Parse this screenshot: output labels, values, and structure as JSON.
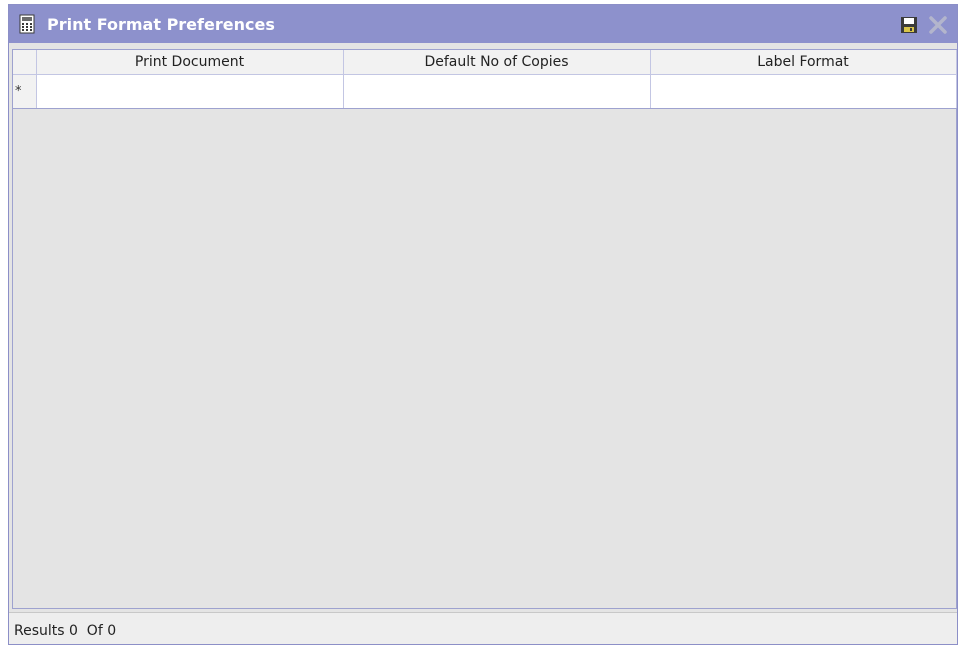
{
  "window": {
    "title": "Print Format Preferences",
    "icons": {
      "title": "calculator-icon",
      "save": "save-icon",
      "close": "close-icon"
    },
    "colors": {
      "titlebar": "#8d91cc",
      "title_text": "#ffffff",
      "grid_border": "#9ea2cf",
      "background": "#e4e4e4"
    }
  },
  "grid": {
    "columns": [
      {
        "label": "Print Document"
      },
      {
        "label": "Default No of Copies"
      },
      {
        "label": "Label Format"
      }
    ],
    "new_row": {
      "marker": "*",
      "cells": [
        "",
        "",
        ""
      ]
    }
  },
  "status": {
    "text": "Results 0  Of 0"
  }
}
